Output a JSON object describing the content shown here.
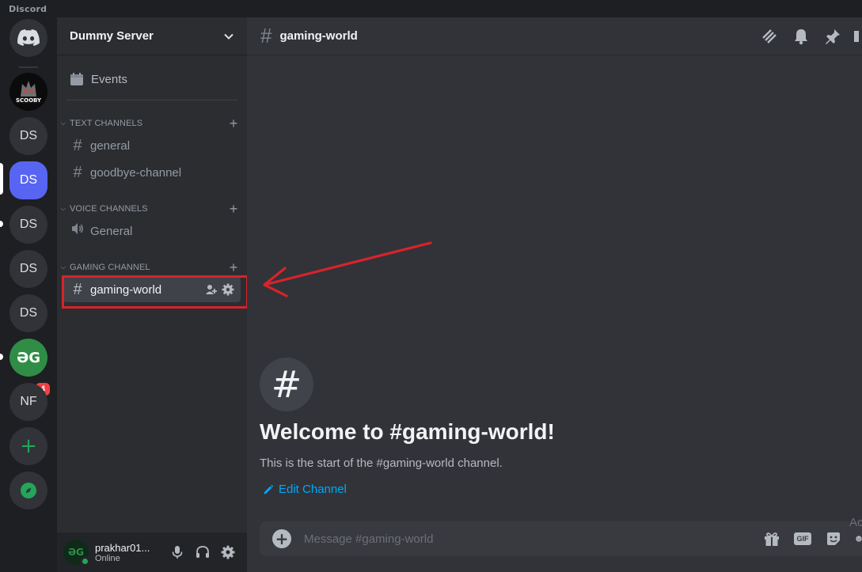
{
  "app": {
    "title": "Discord"
  },
  "rail": {
    "servers": [
      {
        "label": "",
        "kind": "home",
        "icon": "discord-logo-icon"
      },
      {
        "label": "SCOOBY",
        "kind": "image"
      },
      {
        "label": "DS",
        "kind": "initials"
      },
      {
        "label": "DS",
        "kind": "initials",
        "selected": true
      },
      {
        "label": "DS",
        "kind": "initials"
      },
      {
        "label": "DS",
        "kind": "initials"
      },
      {
        "label": "DS",
        "kind": "initials"
      },
      {
        "label": "ƏG",
        "kind": "geeksforgeeks",
        "badge": "4"
      },
      {
        "label": "NF",
        "kind": "initials"
      },
      {
        "label": "+",
        "kind": "add",
        "icon": "plus-icon"
      },
      {
        "label": "",
        "kind": "explore",
        "icon": "compass-icon"
      }
    ]
  },
  "sidebar": {
    "server_name": "Dummy Server",
    "events_label": "Events",
    "categories": [
      {
        "label": "TEXT CHANNELS",
        "channels": [
          {
            "label": "general",
            "type": "text"
          },
          {
            "label": "goodbye-channel",
            "type": "text"
          }
        ]
      },
      {
        "label": "VOICE CHANNELS",
        "channels": [
          {
            "label": "General",
            "type": "voice"
          }
        ]
      },
      {
        "label": "GAMING CHANNEL",
        "channels": [
          {
            "label": "gaming-world",
            "type": "text",
            "active": true
          }
        ]
      }
    ]
  },
  "user": {
    "name": "prakhar01...",
    "status": "Online",
    "avatar_text": "ƏG"
  },
  "channel": {
    "name": "gaming-world",
    "welcome_title": "Welcome to #gaming-world!",
    "welcome_subtitle": "This is the start of the #gaming-world channel.",
    "edit_label": "Edit Channel",
    "composer_placeholder": "Message #gaming-world",
    "gif_label": "GIF"
  },
  "misc": {
    "ad_text": "Ac"
  },
  "colors": {
    "accent": "#5865f2",
    "link": "#00a8fc",
    "highlight": "#d8232a",
    "online": "#23a55a"
  }
}
